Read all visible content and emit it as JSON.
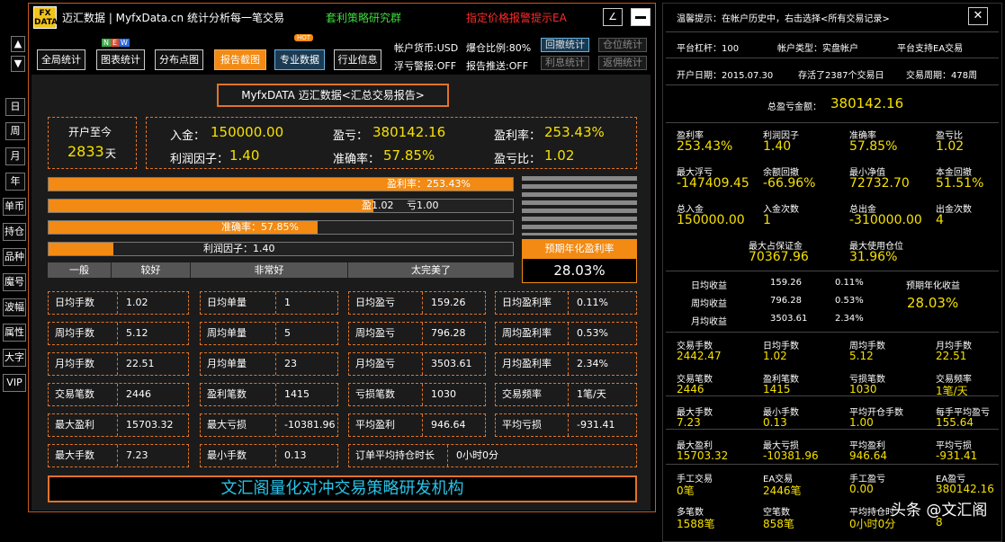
{
  "header": {
    "logo": "FX\nDATA",
    "title": "迈汇数据 | MyfxData.cn  统计分析每一笔交易",
    "group": "套利策略研究群",
    "alert": "指定价格报警提示EA"
  },
  "right_header": {
    "tip": "温馨提示：在帐户历史中，右击选择<所有交易记录>"
  },
  "nav": {
    "all": "全局统计",
    "chart": "图表统计",
    "dist": "分布点图",
    "report": "报告截图",
    "pro": "专业数据",
    "industry": "行业信息",
    "new": "N E W",
    "hot": "HOT"
  },
  "acct": {
    "currency": "帐户货币:USD",
    "risk_ratio": "爆仓比例:80%",
    "float": "浮亏警报:OFF",
    "push": "报告推送:OFF",
    "btn_drawdown": "回撤统计",
    "btn_position": "仓位统计",
    "btn_interest": "利息统计",
    "btn_rebate": "返佣统计"
  },
  "side": {
    "up": "▲",
    "down": "▼",
    "items": [
      "日",
      "周",
      "月",
      "年",
      "单币",
      "持仓",
      "品种",
      "魔号",
      "波幅",
      "属性",
      "大字",
      "VIP"
    ]
  },
  "report_title": "MyfxDATA 迈汇数据<汇总交易报告>",
  "since": {
    "label": "开户至今",
    "days": "2833",
    "unit": "天"
  },
  "summary": {
    "deposit_l": "入金：",
    "deposit": "150000.00",
    "profit_l": "盈亏：",
    "profit": "380142.16",
    "rate_l": "盈利率：",
    "rate": "253.43%",
    "pf_l": "利润因子：",
    "pf": "1.40",
    "acc_l": "准确率：",
    "acc": "57.85%",
    "ratio_l": "盈亏比：",
    "ratio": "1.02"
  },
  "bars": {
    "b1": "盈利率：253.43%",
    "b1_value": 253.43,
    "b2a": "盈1.02",
    "b2b": "亏1.00",
    "b3": "准确率：57.85%",
    "b3_value": 57.85,
    "b4": "利润因子：1.40",
    "grades": [
      "一般",
      "较好",
      "非常好",
      "太完美了"
    ]
  },
  "annual": {
    "label": "预期年化盈利率",
    "value": "28.03%"
  },
  "grid": [
    [
      "日均手数",
      "1.02",
      "日均单量",
      "1",
      "日均盈亏",
      "159.26",
      "日均盈利率",
      "0.11%"
    ],
    [
      "周均手数",
      "5.12",
      "周均单量",
      "5",
      "周均盈亏",
      "796.28",
      "周均盈利率",
      "0.53%"
    ],
    [
      "月均手数",
      "22.51",
      "月均单量",
      "23",
      "月均盈亏",
      "3503.61",
      "月均盈利率",
      "2.34%"
    ],
    [
      "交易笔数",
      "2446",
      "盈利笔数",
      "1415",
      "亏损笔数",
      "1030",
      "交易频率",
      "1笔/天"
    ],
    [
      "最大盈利",
      "15703.32",
      "最大亏损",
      "-10381.96",
      "平均盈利",
      "946.64",
      "平均亏损",
      "-931.41"
    ],
    [
      "最大手数",
      "7.23",
      "最小手数",
      "0.13",
      "订单平均持仓时长",
      "0小时0分",
      "",
      ""
    ]
  ],
  "banner": "文汇阁量化对冲交易策略研发机构",
  "r": {
    "lev": "平台杠杆：100",
    "acct_type": "帐户类型：实盘帐户",
    "ea": "平台支持EA交易",
    "open": "开户日期：2015.07.30",
    "days": "存活了2387个交易日",
    "cycle": "交易周期：478周",
    "total_l": "总盈亏金额：",
    "total": "380142.16",
    "k1": [
      [
        "盈利率",
        "253.43%"
      ],
      [
        "利润因子",
        "1.40"
      ],
      [
        "准确率",
        "57.85%"
      ],
      [
        "盈亏比",
        "1.02"
      ]
    ],
    "k2": [
      [
        "最大浮亏",
        "-147409.45"
      ],
      [
        "余额回撤",
        "-66.96%"
      ],
      [
        "最小净值",
        "72732.70"
      ],
      [
        "本金回撤",
        "51.51%"
      ]
    ],
    "k3": [
      [
        "总入金",
        "150000.00"
      ],
      [
        "入金次数",
        "1"
      ],
      [
        "总出金",
        "-310000.00"
      ],
      [
        "出金次数",
        "4"
      ]
    ],
    "k4": [
      [
        "最大占保证金",
        "70367.96"
      ],
      [
        "最大使用仓位",
        "31.96%"
      ]
    ],
    "avg": [
      [
        "日均收益",
        "159.26",
        "0.11%"
      ],
      [
        "周均收益",
        "796.28",
        "0.53%"
      ],
      [
        "月均收益",
        "3503.61",
        "2.34%"
      ]
    ],
    "annual_l": "预期年化收益",
    "annual": "28.03%",
    "s1": [
      [
        "交易手数",
        "2442.47"
      ],
      [
        "日均手数",
        "1.02"
      ],
      [
        "周均手数",
        "5.12"
      ],
      [
        "月均手数",
        "22.51"
      ]
    ],
    "s2": [
      [
        "交易笔数",
        "2446"
      ],
      [
        "盈利笔数",
        "1415"
      ],
      [
        "亏损笔数",
        "1030"
      ],
      [
        "交易频率",
        "1笔/天"
      ]
    ],
    "s3": [
      [
        "最大手数",
        "7.23"
      ],
      [
        "最小手数",
        "0.13"
      ],
      [
        "平均开仓手数",
        "1.00"
      ],
      [
        "每手平均盈亏",
        "155.64"
      ]
    ],
    "s4": [
      [
        "最大盈利",
        "15703.32"
      ],
      [
        "最大亏损",
        "-10381.96"
      ],
      [
        "平均盈利",
        "946.64"
      ],
      [
        "平均亏损",
        "-931.41"
      ]
    ],
    "s5": [
      [
        "手工交易",
        "0笔"
      ],
      [
        "EA交易",
        "2446笔"
      ],
      [
        "手工盈亏",
        "0.00"
      ],
      [
        "EA盈亏",
        "380142.16"
      ]
    ],
    "s6": [
      [
        "多笔数",
        "1588笔"
      ],
      [
        "空笔数",
        "858笔"
      ],
      [
        "平均持仓时",
        "0小时0分"
      ],
      [
        "",
        "8"
      ]
    ]
  },
  "watermark": "头条 @文汇阁"
}
